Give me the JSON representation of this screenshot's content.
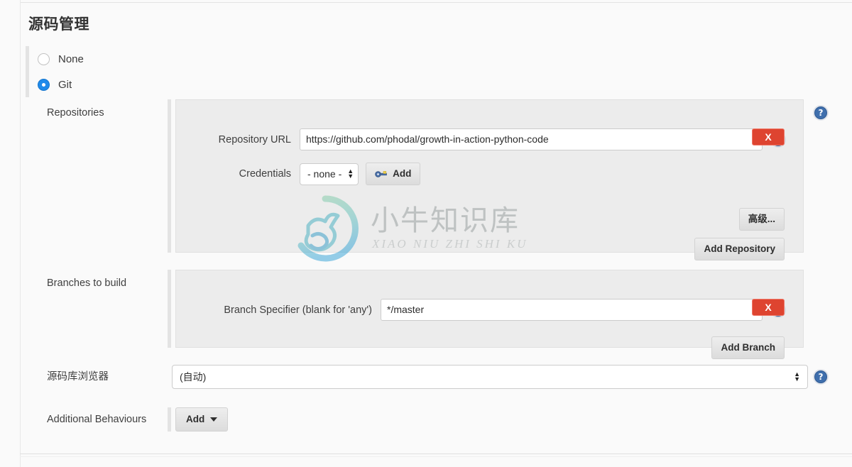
{
  "page": {
    "title": "源码管理"
  },
  "scm": {
    "options": [
      {
        "label": "None",
        "selected": false
      },
      {
        "label": "Git",
        "selected": true
      }
    ]
  },
  "repositories": {
    "row_label": "Repositories",
    "delete_label": "X",
    "url_label": "Repository URL",
    "url_value": "https://github.com/phodal/growth-in-action-python-code",
    "credentials_label": "Credentials",
    "credentials_value": "- none -",
    "credentials_add_label": "Add",
    "advanced_label": "高级...",
    "add_repository_label": "Add Repository",
    "help_icon": "help-circle-icon",
    "row_help_icon": "help-circle-icon"
  },
  "branches": {
    "row_label": "Branches to build",
    "delete_label": "X",
    "specifier_label": "Branch Specifier (blank for 'any')",
    "specifier_value": "*/master",
    "add_branch_label": "Add Branch",
    "help_icon": "help-circle-icon"
  },
  "browser": {
    "row_label": "源码库浏览器",
    "value": "(自动)",
    "help_icon": "help-circle-icon"
  },
  "behaviours": {
    "row_label": "Additional Behaviours",
    "add_label": "Add"
  },
  "watermark": {
    "main": "小牛知识库",
    "sub": "XIAO NIU ZHI SHI KU",
    "logo_icon": "ox-circle-logo-icon"
  },
  "colors": {
    "accent_blue": "#1f8aea",
    "danger_red": "#de4430",
    "help_blue": "#3f6fad",
    "panel_bg": "#ececec",
    "page_bg": "#fafafa"
  }
}
